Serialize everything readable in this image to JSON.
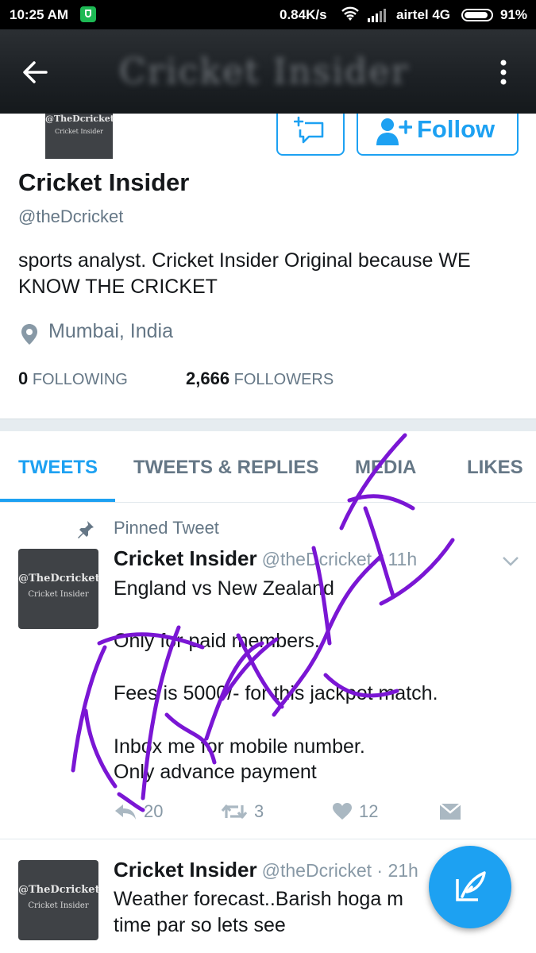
{
  "status_bar": {
    "time": "10:25 AM",
    "speed": "0.84K/s",
    "carrier": "airtel 4G",
    "battery": "91%",
    "battery_level": 0.91
  },
  "header": {
    "blurred_title": "Cricket Insider",
    "back_icon": "arrow-left-icon",
    "overflow_icon": "more-vertical-icon"
  },
  "profile": {
    "avatar_text_line1": "@TheDcricket",
    "avatar_text_line2": "Cricket Insider",
    "name": "Cricket Insider",
    "handle": "@theDcricket",
    "bio": "sports analyst. Cricket Insider Original because WE KNOW THE CRICKET",
    "location": "Mumbai, India",
    "following_count": "0",
    "following_label": "FOLLOWING",
    "followers_count": "2,666",
    "followers_label": "FOLLOWERS",
    "follow_button": "Follow"
  },
  "tabs": [
    {
      "label": "TWEETS",
      "active": true
    },
    {
      "label": "TWEETS & REPLIES",
      "active": false
    },
    {
      "label": "MEDIA",
      "active": false
    },
    {
      "label": "LIKES",
      "active": false
    }
  ],
  "tweets": [
    {
      "pinned_label": "Pinned Tweet",
      "author": "Cricket Insider",
      "meta": "@theDcricket · 11h",
      "lines": [
        "England vs New Zealand",
        "Only for paid members.",
        "Fees is 5000/- for this jackpot match.",
        "Inbox me for mobile number.",
        "Only advance payment"
      ],
      "replies": "20",
      "retweets": "3",
      "likes": "12"
    },
    {
      "author": "Cricket Insider",
      "meta": "@theDcricket · 21h",
      "lines": [
        "Weather forecast..Barish hoga m",
        "time par so lets see"
      ]
    }
  ],
  "overlay": {
    "handwritten_text": "FAKE",
    "ink_color": "#7a16d4"
  },
  "colors": {
    "accent": "#1da1f2",
    "secondary_text": "#657786"
  }
}
